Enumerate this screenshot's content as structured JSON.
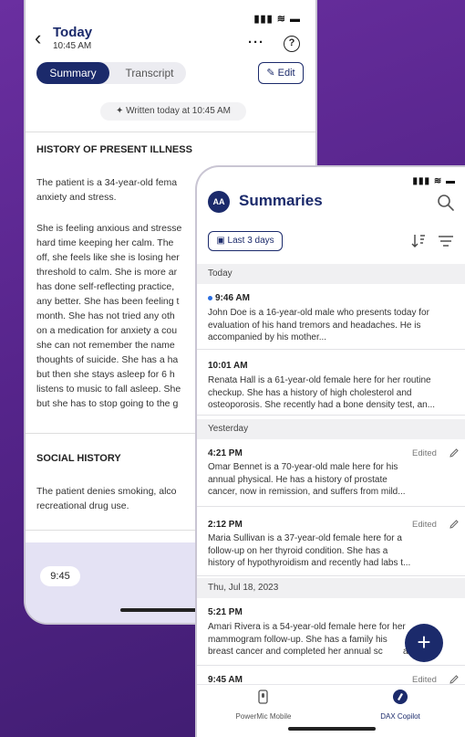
{
  "back_phone": {
    "status": "▮▮▮ ≋ ▬",
    "back_glyph": "‹",
    "header": {
      "title": "Today",
      "time": "10:45 AM",
      "more_glyph": "···",
      "help_glyph": "?"
    },
    "tabs": [
      {
        "label": "Summary"
      },
      {
        "label": "Transcript"
      }
    ],
    "edit_label": "✎ Edit",
    "written_label": "✦ Written today at 10:45 AM",
    "sections": [
      {
        "heading": "HISTORY OF PRESENT ILLNESS",
        "paragraphs": [
          "The patient is a 34-year-old fema\nanxiety and stress.",
          "She is feeling anxious and stresse\nhard time keeping her calm. The \noff, she feels like she is losing her\nthreshold to calm. She is more ar\nhas done self-reflecting practice,\nany better. She has been feeling t\nmonth. She has not tried any oth\non a medication for anxiety a cou\nshe can not remember the name\nthoughts of suicide. She has a ha\nbut then she stays asleep for 6 h\nlistens to music to fall asleep. She\nbut she has to stop going to the g"
        ]
      },
      {
        "heading": "SOCIAL HISTORY",
        "paragraphs": [
          "The patient denies smoking, alco\nrecreational drug use."
        ]
      }
    ],
    "player_time": "9:45"
  },
  "front_phone": {
    "status": "▮▮▮ ≋ ▬",
    "avatar_initials": "AA",
    "title": "Summaries",
    "filter_chip": "▣ Last 3 days",
    "groups": [
      {
        "label": "Today",
        "items": [
          {
            "time": "9:46 AM",
            "unread": true,
            "edited": "",
            "text": "John Doe is a 16-year-old male who presents today for\nevaluation of his hand tremors and headaches. He is\naccompanied by his mother..."
          },
          {
            "time": "10:01 AM",
            "unread": false,
            "edited": "",
            "text": "Renata Hall is a 61-year-old female here for her routine\ncheckup. She has a history of high cholesterol and\nosteoporosis. She recently had a bone density test, an..."
          }
        ]
      },
      {
        "label": "Yesterday",
        "items": [
          {
            "time": "4:21 PM",
            "unread": false,
            "edited": "Edited",
            "text": "Omar Bennet is a 70-year-old male here for his\nannual physical. He has a history of prostate\ncancer, now in remission, and suffers from mild..."
          },
          {
            "time": "2:12 PM",
            "unread": false,
            "edited": "Edited",
            "text": "Maria Sullivan is a 37-year-old female here for a\nfollow-up on her thyroid condition. She has a\nhistory of hypothyroidism and recently had labs t..."
          }
        ]
      },
      {
        "label": "Thu, Jul 18, 2023",
        "items": [
          {
            "time": "5:21 PM",
            "unread": false,
            "edited": "",
            "text": "Amari Rivera is a 54-year-old female here for her\nmammogram follow-up. She has a family his\nbreast cancer and completed her annual sc        as..."
          },
          {
            "time": "9:45 AM",
            "unread": false,
            "edited": "Edited",
            "text": ""
          }
        ]
      }
    ],
    "fab_glyph": "+",
    "nav": [
      {
        "label": "PowerMic Mobile"
      },
      {
        "label": "DAX Copilot"
      }
    ]
  }
}
